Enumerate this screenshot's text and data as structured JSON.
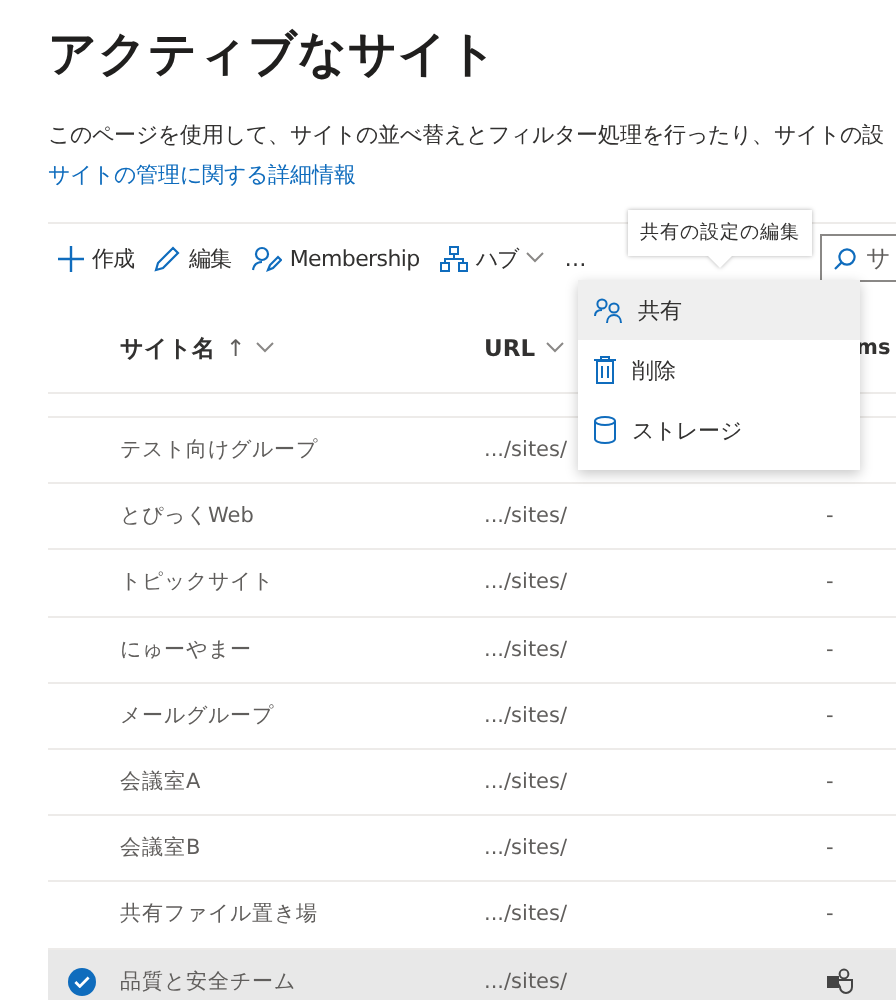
{
  "page": {
    "title": "アクティブなサイト",
    "description": "このページを使用して、サイトの並べ替えとフィルター処理を行ったり、サイトの設",
    "link": "サイトの管理に関する詳細情報"
  },
  "toolbar": {
    "items": [
      {
        "kind": "plus",
        "label": "作成"
      },
      {
        "kind": "pencil",
        "label": "編集"
      },
      {
        "kind": "person",
        "label": "Membership"
      },
      {
        "kind": "hub",
        "label": "ハブ",
        "dropdown": true
      },
      {
        "kind": "more",
        "label": "…"
      }
    ],
    "search": {
      "placeholder": "サ"
    }
  },
  "tooltip": {
    "text": "共有の設定の編集"
  },
  "menu": {
    "items": [
      {
        "kind": "share",
        "label": "共有",
        "selected": true
      },
      {
        "kind": "trash",
        "label": "削除",
        "selected": false
      },
      {
        "kind": "storage",
        "label": "ストレージ",
        "selected": false
      }
    ]
  },
  "table": {
    "columns": [
      {
        "label": "サイト名",
        "sort_mark": "↑"
      },
      {
        "label": "URL"
      },
      {
        "label": "ms"
      }
    ],
    "rows": [
      {
        "name": "テスト向けグループ",
        "url": ".../sites/",
        "teams_icon": false,
        "selected": false
      },
      {
        "name": "とぴっくWeb",
        "url": ".../sites/",
        "column_3": "-",
        "teams_icon": false,
        "selected": false
      },
      {
        "name": "トピックサイト",
        "url": ".../sites/",
        "column_3": "-",
        "teams_icon": false,
        "selected": false
      },
      {
        "name": "にゅーやまー",
        "url": ".../sites/",
        "column_3": "-",
        "teams_icon": false,
        "selected": false
      },
      {
        "name": "メールグループ",
        "url": ".../sites/",
        "column_3": "-",
        "teams_icon": false,
        "selected": false
      },
      {
        "name": "会議室A",
        "url": ".../sites/",
        "column_3": "-",
        "teams_icon": false,
        "selected": false
      },
      {
        "name": "会議室B",
        "url": ".../sites/",
        "column_3": "-",
        "teams_icon": false,
        "selected": false
      },
      {
        "name": "共有ファイル置き場",
        "url": ".../sites/",
        "column_3": "-",
        "teams_icon": false,
        "selected": false
      },
      {
        "name": "品質と安全チーム",
        "url": ".../sites/",
        "teams_icon": true,
        "selected": true
      }
    ]
  }
}
